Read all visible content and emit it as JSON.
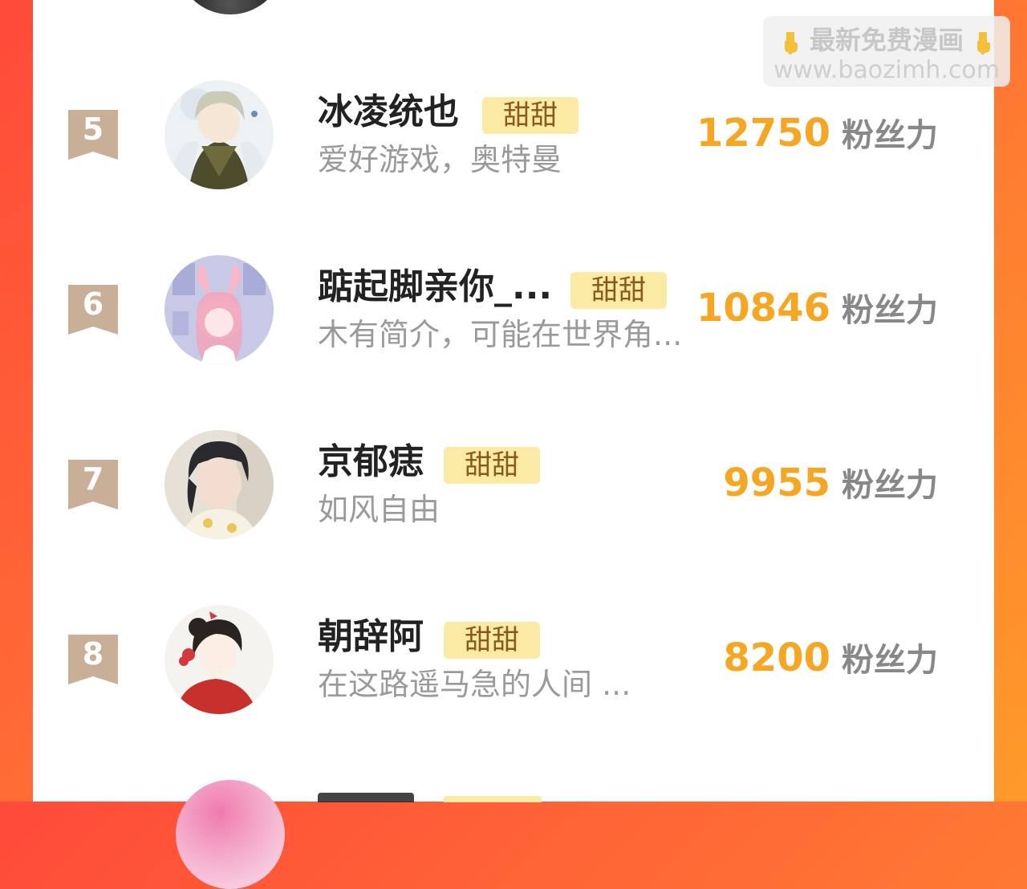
{
  "watermark": {
    "line1": "最新免费漫画",
    "line2": "www.baozimh.com",
    "icon": "pointing-down-hand-icon"
  },
  "colors": {
    "accent": "#f5a623",
    "tag_bg": "#fbeaa4",
    "tag_text": "#8a5a1b",
    "rank_badge": "#c9ae98",
    "frame_gradient_start": "#ff4a3a",
    "frame_gradient_end": "#ff9a2a"
  },
  "ranking": [
    {
      "rank": "5",
      "name": "冰凌统也",
      "tag": "甜甜",
      "bio": "爱好游戏，奥特曼",
      "score": "12750",
      "score_label": "粉丝力"
    },
    {
      "rank": "6",
      "name": "踮起脚亲你_...",
      "tag": "甜甜",
      "bio": "木有简介，可能在世界角...",
      "score": "10846",
      "score_label": "粉丝力"
    },
    {
      "rank": "7",
      "name": "京郁痣",
      "tag": "甜甜",
      "bio": "如风自由",
      "score": "9955",
      "score_label": "粉丝力"
    },
    {
      "rank": "8",
      "name": "朝辞阿",
      "tag": "甜甜",
      "bio": "在这路遥马急的人间 ...",
      "score": "8200",
      "score_label": "粉丝力"
    }
  ]
}
